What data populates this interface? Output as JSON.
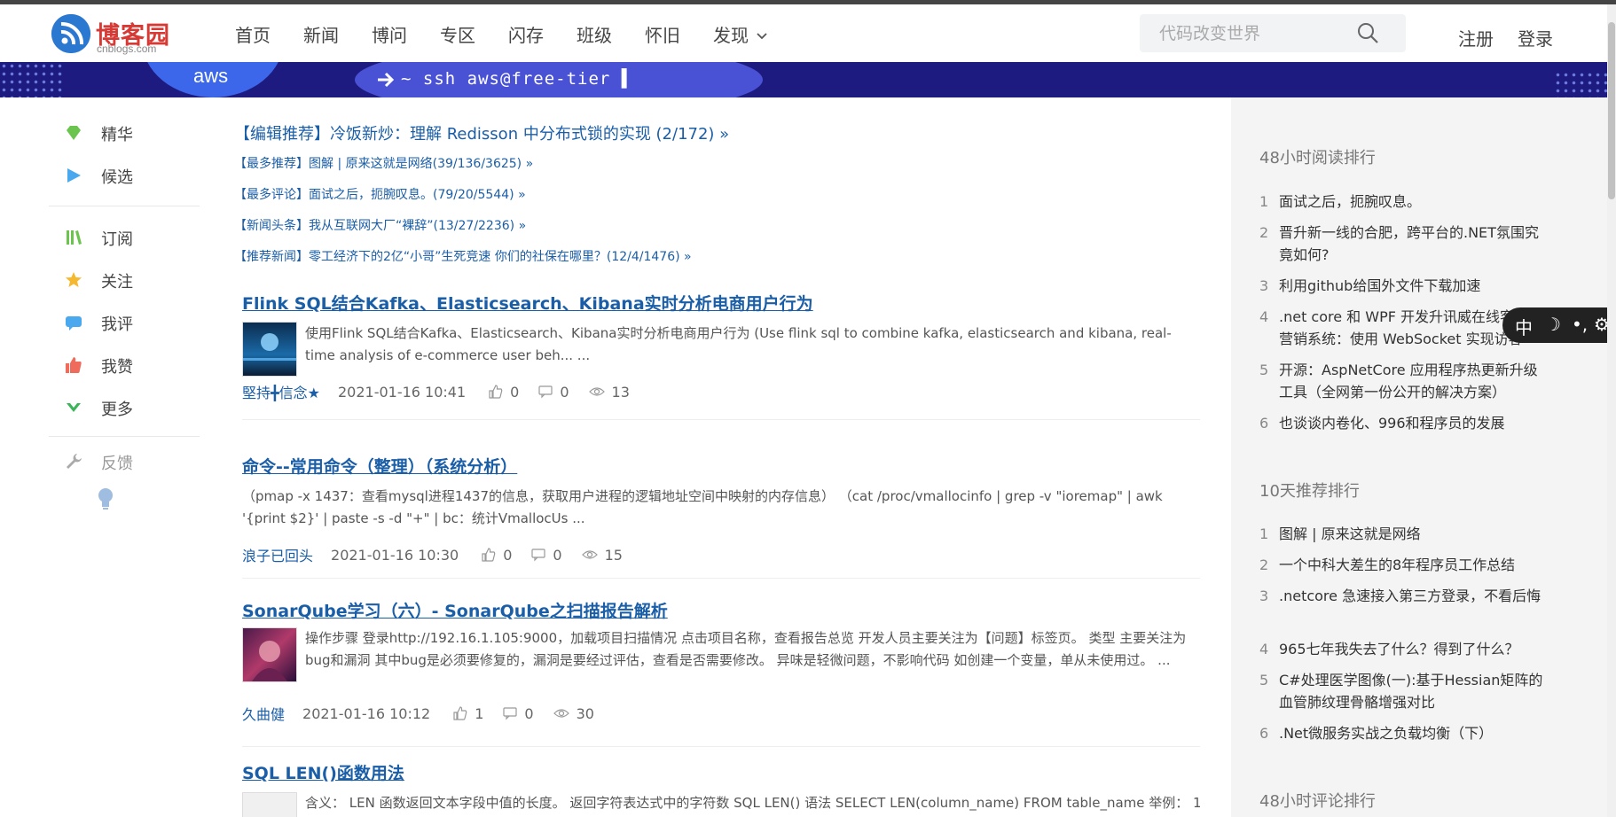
{
  "nav": {
    "logo_name": "博客园",
    "logo_sub": "cnblogs.com",
    "links": [
      {
        "label": "首页"
      },
      {
        "label": "新闻"
      },
      {
        "label": "博问"
      },
      {
        "label": "专区"
      },
      {
        "label": "闪存"
      },
      {
        "label": "班级"
      },
      {
        "label": "怀旧"
      },
      {
        "label": "发现"
      }
    ],
    "search_placeholder": "代码改变世界",
    "register": "注册",
    "login": "登录"
  },
  "banner": {
    "brand": "aws",
    "command": "~ ssh aws@free-tier ▌"
  },
  "left_sidebar": {
    "items": [
      {
        "label": "精华",
        "icon": "gem-icon",
        "color": "#6ac44d"
      },
      {
        "label": "候选",
        "icon": "play-icon",
        "color": "#4aa8ee"
      },
      {
        "label": "订阅",
        "icon": "books-icon",
        "color": "#6ac44d"
      },
      {
        "label": "关注",
        "icon": "star-icon",
        "color": "#f5b82e"
      },
      {
        "label": "我评",
        "icon": "comment-icon",
        "color": "#4aa8ee"
      },
      {
        "label": "我赞",
        "icon": "thumbs-up-icon",
        "color": "#ef6b5c"
      },
      {
        "label": "更多",
        "icon": "chevron-down-icon",
        "color": "#3cb55a"
      }
    ],
    "feedback": "反馈"
  },
  "recommendations": [
    {
      "text": "【编辑推荐】冷饭新炒：理解 Redisson 中分布式锁的实现 (2/172) »"
    },
    {
      "text": "【最多推荐】图解 | 原来这就是网络(39/136/3625) »"
    },
    {
      "text": "【最多评论】面试之后，扼腕叹息。(79/20/5544) »"
    },
    {
      "text": "【新闻头条】我从互联网大厂“裸辞”(13/27/2236) »"
    },
    {
      "text": "【推荐新闻】零工经济下的2亿“小哥”生死竞速 你们的社保在哪里？(12/4/1476) »"
    }
  ],
  "posts": [
    {
      "title": "Flink SQL结合Kafka、Elasticsearch、Kibana实时分析电商用户行为",
      "summary": "使用Flink SQL结合Kafka、Elasticsearch、Kibana实时分析电商用户行为 (Use flink sql to combine kafka, elasticsearch and kibana, real-time analysis of e-commerce user beh... ...",
      "author": "堅持╋信念★",
      "date": "2021-01-16 10:41",
      "likes": "0",
      "comments": "0",
      "views": "13"
    },
    {
      "title": "命令--常用命令（整理）（系统分析）",
      "summary": "（pmap -x 1437：查看mysql进程1437的信息，获取用户进程的逻辑地址空间中映射的内存信息） （cat /proc/vmallocinfo | grep -v \"ioremap\" | awk '{print $2}' | paste -s -d \"+\" | bc：统计VmallocUs ...",
      "author": "浪子已回头",
      "date": "2021-01-16 10:30",
      "likes": "0",
      "comments": "0",
      "views": "15"
    },
    {
      "title": "SonarQube学习（六）- SonarQube之扫描报告解析",
      "summary": "操作步骤 登录http://192.16.1.105:9000，加载项目扫描情况 点击项目名称，查看报告总览 开发人员主要关注为【问题】标签页。 类型 主要关注为bug和漏洞 其中bug是必须要修复的，漏洞是要经过评估，查看是否需要修改。 异味是轻微问题，不影响代码 如创建一个变量，单从未使用过。 ...",
      "author": "久曲健",
      "date": "2021-01-16 10:12",
      "likes": "1",
      "comments": "0",
      "views": "30"
    },
    {
      "title": "SQL LEN()函数用法",
      "summary": "含义： LEN 函数返回文本字段中值的长度。 返回字符表达式中的字符数 SQL LEN() 语法 SELECT LEN(column_name) FROM table_name 举例： 1、"
    }
  ],
  "right_sidebar": {
    "sections": [
      {
        "title": "48小时阅读排行",
        "items": [
          {
            "n": "1",
            "t": "面试之后，扼腕叹息。"
          },
          {
            "n": "2",
            "t": "晋升新一线的合肥，跨平台的.NET氛围究竟如何?"
          },
          {
            "n": "3",
            "t": "利用github给国外文件下载加速"
          },
          {
            "n": "4",
            "t": ".net core 和 WPF 开发升讯威在线客服与营销系统：使用 WebSocket 实现访客"
          },
          {
            "n": "5",
            "t": "开源：AspNetCore 应用程序热更新升级工具（全网第一份公开的解决方案）"
          },
          {
            "n": "6",
            "t": "也谈谈内卷化、996和程序员的发展"
          }
        ]
      },
      {
        "title": "10天推荐排行",
        "items": [
          {
            "n": "1",
            "t": "图解 | 原来这就是网络"
          },
          {
            "n": "2",
            "t": "一个中科大差生的8年程序员工作总结"
          },
          {
            "n": "3",
            "t": ".netcore 急速接入第三方登录，不看后悔"
          },
          {
            "n": "4",
            "t": "965七年我失去了什么？得到了什么？"
          },
          {
            "n": "5",
            "t": "C#处理医学图像(一):基于Hessian矩阵的血管肺纹理骨骼增强对比"
          },
          {
            "n": "6",
            "t": ".Net微服务实战之负载均衡（下）"
          }
        ]
      },
      {
        "title": "48小时评论排行",
        "items": []
      }
    ]
  },
  "floatbar": {
    "lang": "中",
    "moon": "☽",
    "punct": "•,",
    "gear": "⚙"
  }
}
